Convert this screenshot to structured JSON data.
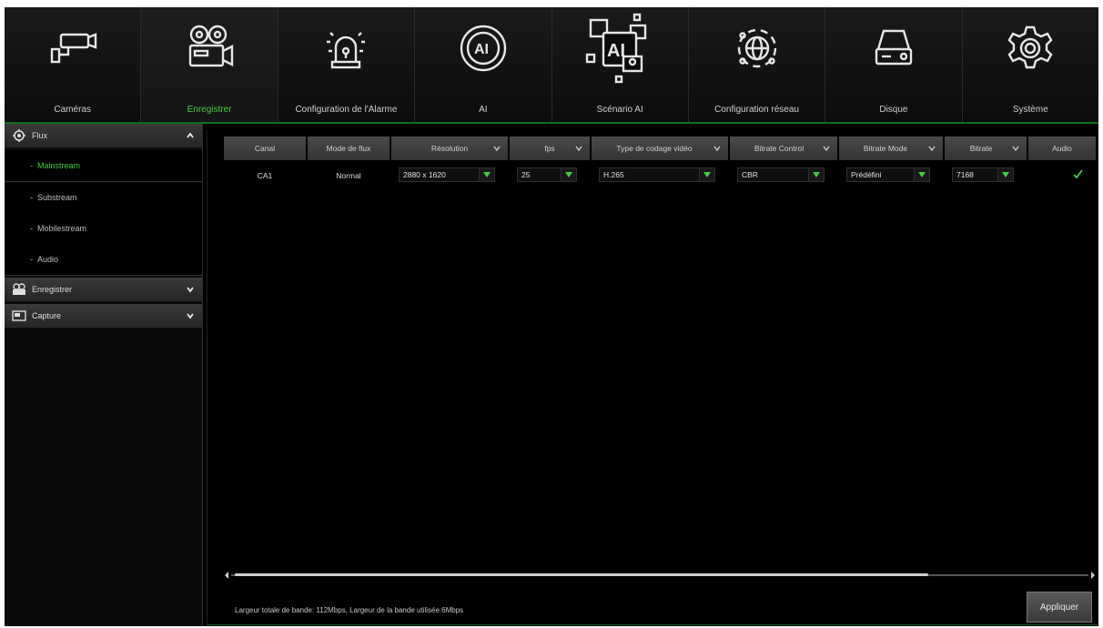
{
  "nav": {
    "items": [
      {
        "label": "Caméras",
        "icon": "camera-icon"
      },
      {
        "label": "Enregistrer",
        "icon": "record-icon",
        "active": true
      },
      {
        "label": "Configuration de l'Alarme",
        "icon": "alarm-icon"
      },
      {
        "label": "AI",
        "icon": "ai-icon"
      },
      {
        "label": "Scénario AI",
        "icon": "ai-scenario-icon"
      },
      {
        "label": "Configuration réseau",
        "icon": "network-icon"
      },
      {
        "label": "Disque",
        "icon": "disk-icon"
      },
      {
        "label": "Système",
        "icon": "system-gear-icon"
      }
    ]
  },
  "sidebar": {
    "flux": {
      "title": "Flux",
      "items": [
        "Mainstream",
        "Substream",
        "Mobilestream",
        "Audio"
      ]
    },
    "record": {
      "title": "Enregistrer"
    },
    "capture": {
      "title": "Capture"
    }
  },
  "table": {
    "headers": [
      "Canal",
      "Mode de flux",
      "Résolution",
      "fps",
      "Type de codage vidéo",
      "Bitrate Control",
      "Bitrate Mode",
      "Bitrate",
      "Audio"
    ],
    "row": {
      "canal": "CA1",
      "mode": "Normal",
      "resolution": "2880 x 1620",
      "fps": "25",
      "codec": "H.265",
      "bitrate_control": "CBR",
      "bitrate_mode": "Prédéfini",
      "bitrate": "7168",
      "audio": true
    }
  },
  "footer": {
    "bandwidth": "Largeur totale de bande: 112Mbps, Largeur de la bande utilisée:6Mbps",
    "apply_label": "Appliquer"
  },
  "colors": {
    "accent": "#3fcf3f",
    "divider": "#0c6e1c"
  }
}
